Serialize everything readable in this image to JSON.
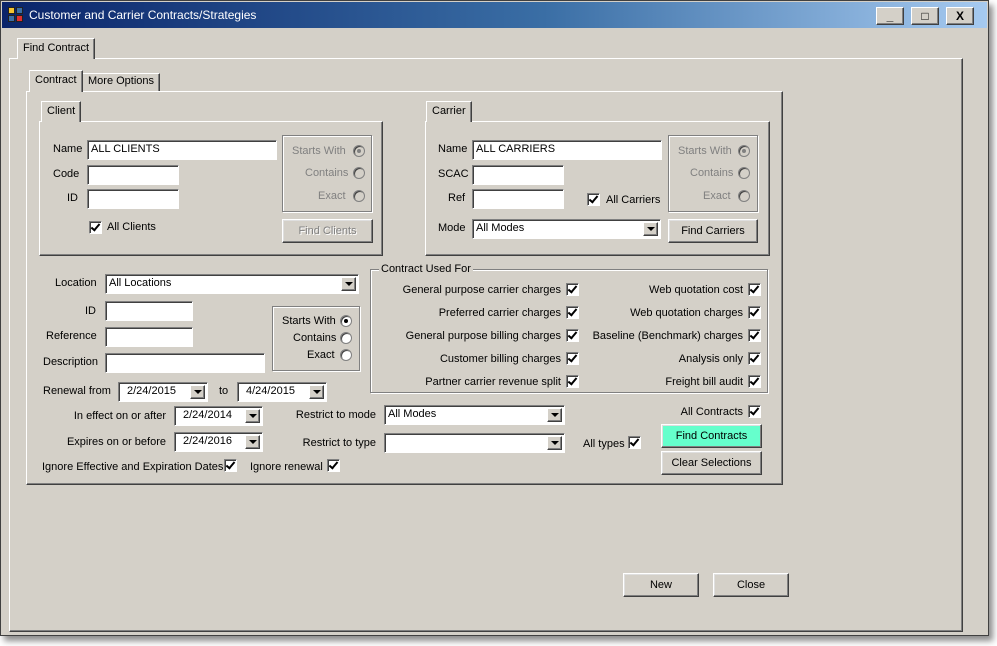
{
  "window": {
    "title": "Customer and Carrier Contracts/Strategies",
    "minimize_glyph": "_",
    "maximize_glyph": "□",
    "close_glyph": "X"
  },
  "outer_tab": {
    "label": "Find Contract"
  },
  "inner_tabs": [
    {
      "label": "Contract"
    },
    {
      "label": "More Options"
    }
  ],
  "client": {
    "tab_label": "Client",
    "name_label": "Name",
    "name_value": "ALL CLIENTS",
    "code_label": "Code",
    "code_value": "",
    "id_label": "ID",
    "id_value": "",
    "all_label": "All Clients",
    "all_checked": true,
    "match": {
      "starts_with": "Starts With",
      "contains": "Contains",
      "exact": "Exact",
      "selected": "starts_with"
    },
    "find_button": "Find Clients"
  },
  "carrier": {
    "tab_label": "Carrier",
    "name_label": "Name",
    "name_value": "ALL CARRIERS",
    "scac_label": "SCAC",
    "scac_value": "",
    "ref_label": "Ref",
    "ref_value": "",
    "all_label": "All Carriers",
    "all_checked": true,
    "mode_label": "Mode",
    "mode_value": "All Modes",
    "match": {
      "starts_with": "Starts With",
      "contains": "Contains",
      "exact": "Exact",
      "selected": "starts_with"
    },
    "find_button": "Find Carriers"
  },
  "location": {
    "location_label": "Location",
    "location_value": "All Locations",
    "id_label": "ID",
    "id_value": "",
    "reference_label": "Reference",
    "reference_value": "",
    "description_label": "Description",
    "description_value": "",
    "match": {
      "starts_with": "Starts With",
      "contains": "Contains",
      "exact": "Exact",
      "selected": "starts_with"
    }
  },
  "contract_used_for": {
    "legend": "Contract Used For",
    "left": [
      {
        "label": "General purpose carrier charges",
        "checked": true
      },
      {
        "label": "Preferred carrier charges",
        "checked": true
      },
      {
        "label": "General purpose billing charges",
        "checked": true
      },
      {
        "label": "Customer billing charges",
        "checked": true
      },
      {
        "label": "Partner carrier revenue split",
        "checked": true
      }
    ],
    "right": [
      {
        "label": "Web quotation cost",
        "checked": true
      },
      {
        "label": "Web quotation charges",
        "checked": true
      },
      {
        "label": "Baseline (Benchmark) charges",
        "checked": true
      },
      {
        "label": "Analysis only",
        "checked": true
      },
      {
        "label": "Freight bill audit",
        "checked": true
      }
    ]
  },
  "dates": {
    "renewal_from_label": "Renewal from",
    "renewal_from": "2/24/2015",
    "to_label": "to",
    "renewal_to": "4/24/2015",
    "in_effect_label": "In effect on or after",
    "in_effect": "2/24/2014",
    "expires_label": "Expires on or before",
    "expires": "2/24/2016",
    "ignore_dates_label": "Ignore Effective and Expiration Dates",
    "ignore_dates_checked": true,
    "ignore_renewal_label": "Ignore renewal",
    "ignore_renewal_checked": true
  },
  "restrict": {
    "mode_label": "Restrict to mode",
    "mode_value": "All Modes",
    "type_label": "Restrict to type",
    "type_value": "",
    "all_types_label": "All types",
    "all_types_checked": true
  },
  "actions": {
    "all_contracts_label": "All Contracts",
    "all_contracts_checked": true,
    "find_contracts": "Find Contracts",
    "clear_selections": "Clear Selections",
    "new": "New",
    "close": "Close"
  },
  "colors": {
    "accent": "#66ffcc",
    "window": "#d4d0c8",
    "title_start": "#0a246a",
    "title_end": "#a6caf0"
  }
}
